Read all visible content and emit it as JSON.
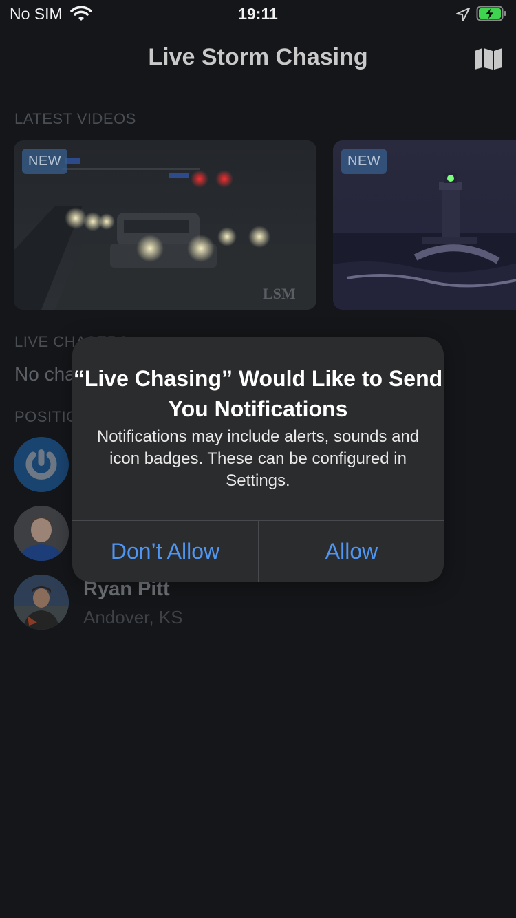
{
  "status_bar": {
    "carrier": "No SIM",
    "time": "19:11",
    "icons": [
      "wifi-icon",
      "location-arrow-icon",
      "battery-charging-icon"
    ]
  },
  "nav": {
    "title": "Live Storm Chasing",
    "right_icon": "map-icon"
  },
  "sections": {
    "latest_videos": "LATEST VIDEOS",
    "live_chasers": "LIVE CHASERS",
    "positions": "POSITIONS"
  },
  "videos": [
    {
      "badge": "NEW",
      "watermark": "LSM"
    },
    {
      "badge": "NEW"
    }
  ],
  "live_chasers_empty": "No chasers live",
  "people": [
    {
      "name": "Ryan Pitt",
      "location": "Andover, KS"
    }
  ],
  "alert": {
    "title": "“Live Chasing” Would Like to Send You Notifications",
    "message": "Notifications may include alerts, sounds and icon badges. These can be configured in Settings.",
    "deny_label": "Don’t Allow",
    "allow_label": "Allow"
  },
  "colors": {
    "background": "#141619",
    "alert_background": "#2b2c2e",
    "alert_button": "#4f95f2",
    "badge": "#375f8c"
  }
}
